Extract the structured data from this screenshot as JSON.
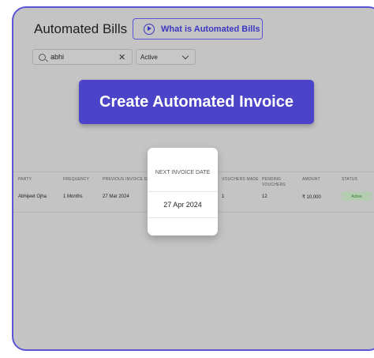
{
  "header": {
    "title": "Automated Bills",
    "help_button_label": "What is Automated Bills"
  },
  "filters": {
    "search_value": "abhi",
    "status_selected": "Active"
  },
  "cta": {
    "label": "Create Automated Invoice"
  },
  "table": {
    "columns": [
      "PARTY",
      "FREQUENCY",
      "PREVIOUS INVOICE DATE",
      "NEXT INVOICE DATE",
      "VOUCHERS MADE",
      "PENDING VOUCHERS",
      "AMOUNT",
      "STATUS"
    ],
    "rows": [
      {
        "party": "Abhijeet Ojha",
        "frequency": "1 Months",
        "previous_invoice_date": "27 Mar 2024",
        "next_invoice_date": "27 Apr 2024",
        "vouchers_made": "1",
        "pending_vouchers": "12",
        "amount": "₹ 10,000",
        "status": "Active"
      }
    ]
  },
  "colors": {
    "accent": "#4b44c9",
    "frame_border": "#5b55d6",
    "status_active_bg": "#b4cdb1",
    "status_active_text": "#2f7d2a"
  }
}
